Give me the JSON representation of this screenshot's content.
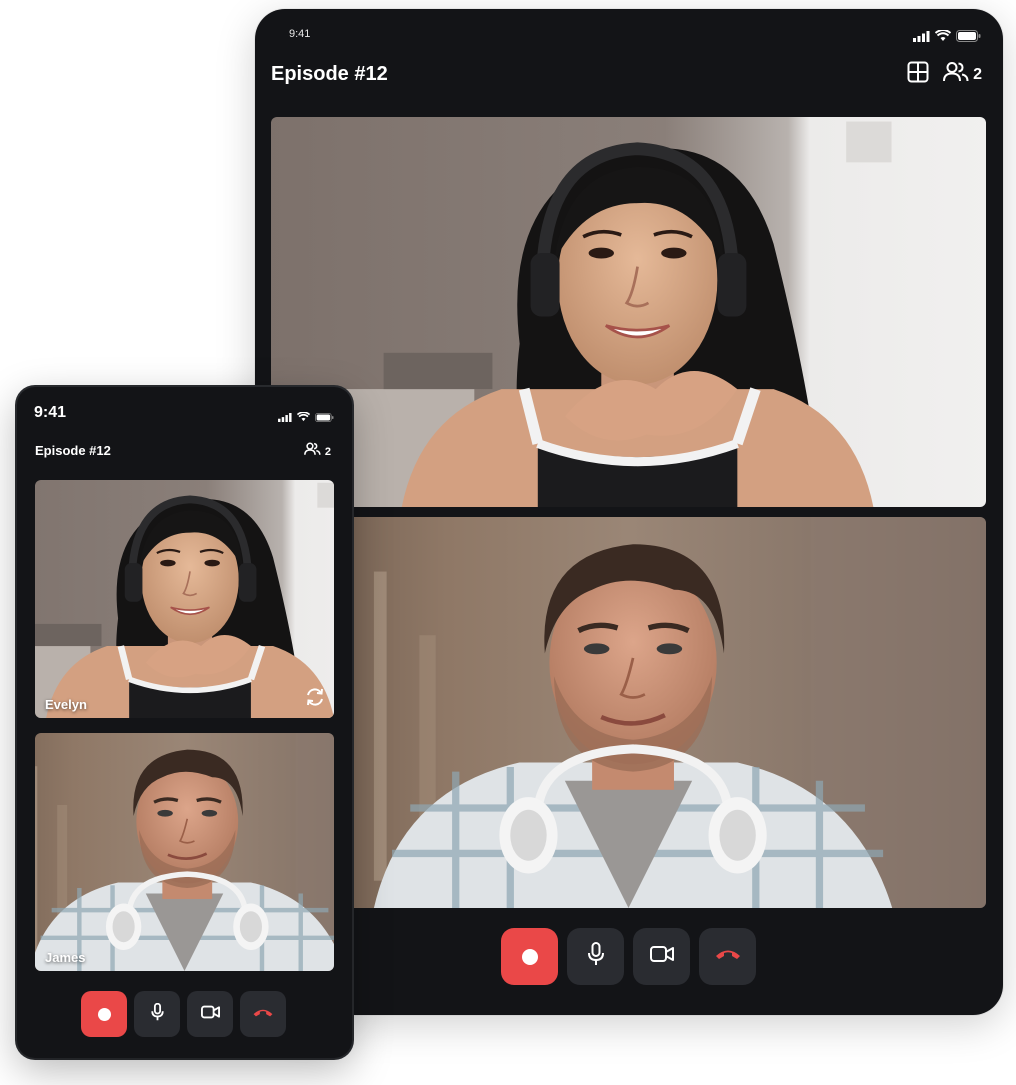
{
  "status": {
    "time": "9:41"
  },
  "session": {
    "title": "Episode #12",
    "participant_count": "2"
  },
  "participants": [
    {
      "name": "Evelyn"
    },
    {
      "name": "James"
    }
  ],
  "controls": [
    "record",
    "microphone",
    "camera",
    "end-call"
  ],
  "icons": [
    "signal-icon",
    "wifi-icon",
    "battery-icon",
    "grid-view-icon",
    "participants-icon",
    "flip-camera-icon",
    "microphone-icon",
    "video-camera-icon",
    "phone-hangup-icon"
  ],
  "colors": {
    "background": "#131417",
    "button": "#2a2c31",
    "record": "#ea4848",
    "hangup": "#ea4848"
  }
}
